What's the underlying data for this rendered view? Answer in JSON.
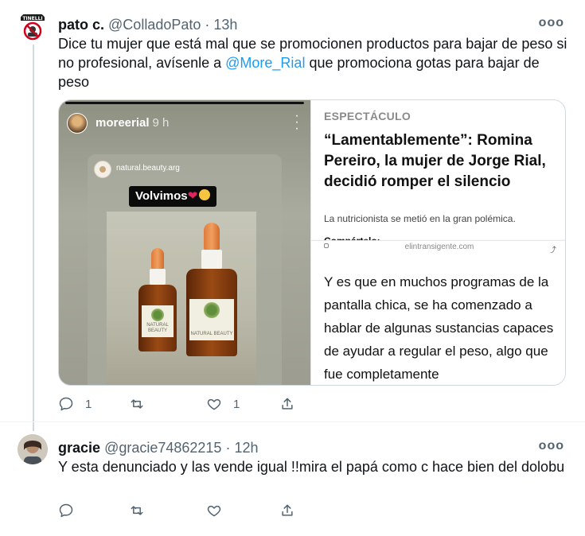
{
  "tweets": [
    {
      "display_name": "pato c.",
      "handle": "@ColladoPato",
      "separator": "·",
      "time": "13h",
      "more_label": "ooo",
      "text_before": "Dice tu mujer que está mal que se promocionen productos para bajar de peso si no  profesional, avísenle a ",
      "mention": "@More_Rial",
      "text_after": " que promociona gotas para bajar de peso",
      "actions": {
        "reply_count": "1",
        "retweet_count": "",
        "like_count": "1"
      },
      "avatar_badge": "TINELLI"
    },
    {
      "display_name": "gracie",
      "handle": "@gracie74862215",
      "separator": "·",
      "time": "12h",
      "more_label": "ooo",
      "text": "Y esta denunciado y las vende igual !!mira el papá como c hace bien del dolobu",
      "actions": {
        "reply_count": "",
        "retweet_count": "",
        "like_count": ""
      }
    }
  ],
  "card": {
    "story": {
      "username": "moreerial",
      "time": "9 h",
      "inner_username": "natural.beauty.arg",
      "sticker_text": "Volvimos",
      "bottle_label": "NATURAL BEAUTY"
    },
    "article": {
      "kicker": "ESPECTÁCULO",
      "headline": "“Lamentablemente”: Romina Pereiro, la mujer de Jorge Rial, decidió romper el silencio",
      "summary": "La nutricionista se metió en la gran polémica.",
      "share_label": "Compártelo:",
      "domain": "elintransigente.com",
      "body": "Y es que en muchos programas de la pantalla chica, se ha comenzado a hablar de algunas sustancias capaces de ayudar a regular el peso, algo que fue completamente"
    }
  },
  "colors": {
    "link": "#1d9bf0",
    "muted": "#536471",
    "text": "#0f1419",
    "border": "#cfd9de"
  },
  "icons": [
    "reply-icon",
    "retweet-icon",
    "like-icon",
    "share-icon",
    "more-icon"
  ]
}
